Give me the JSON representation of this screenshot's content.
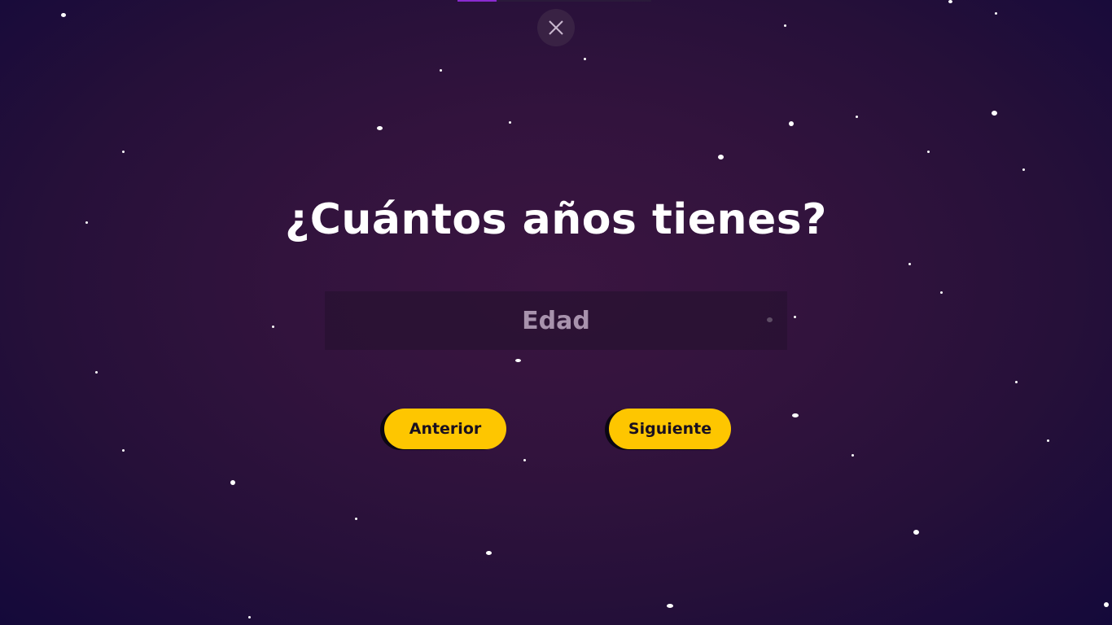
{
  "progress": {
    "fraction": 0.2
  },
  "close_icon": "close-icon",
  "question": {
    "text": "¿Cuántos años tienes?"
  },
  "age_input": {
    "placeholder": "Edad",
    "value": ""
  },
  "buttons": {
    "previous_label": "Anterior",
    "next_label": "Siguiente"
  },
  "colors": {
    "background": "#32133d",
    "button": "#fec600",
    "accent": "#8a2bd0"
  }
}
